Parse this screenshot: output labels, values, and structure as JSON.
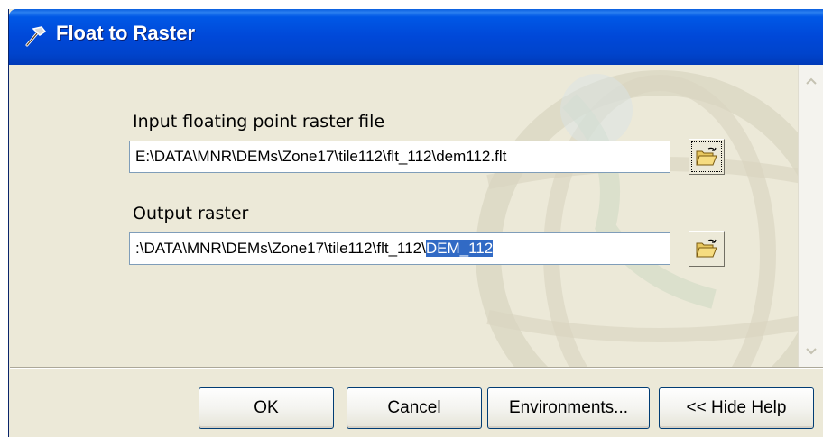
{
  "window": {
    "title": "Float to Raster",
    "title_icon": "hammer-icon"
  },
  "form": {
    "input_label": "Input floating point raster file",
    "input_value": "E:\\DATA\\MNR\\DEMs\\Zone17\\tile112\\flt_112\\dem112.flt",
    "output_label": "Output raster",
    "output_value_prefix": ":\\DATA\\MNR\\DEMs\\Zone17\\tile112\\flt_112\\",
    "output_value_selected": "DEM_112",
    "browse_icon": "open-folder-icon"
  },
  "buttons": {
    "ok": "OK",
    "cancel": "Cancel",
    "environments": "Environments...",
    "hide_help": "<< Hide Help"
  },
  "colors": {
    "titlebar": "#0054e3",
    "dialog_bg": "#ece9d8",
    "selection": "#316ac5"
  }
}
